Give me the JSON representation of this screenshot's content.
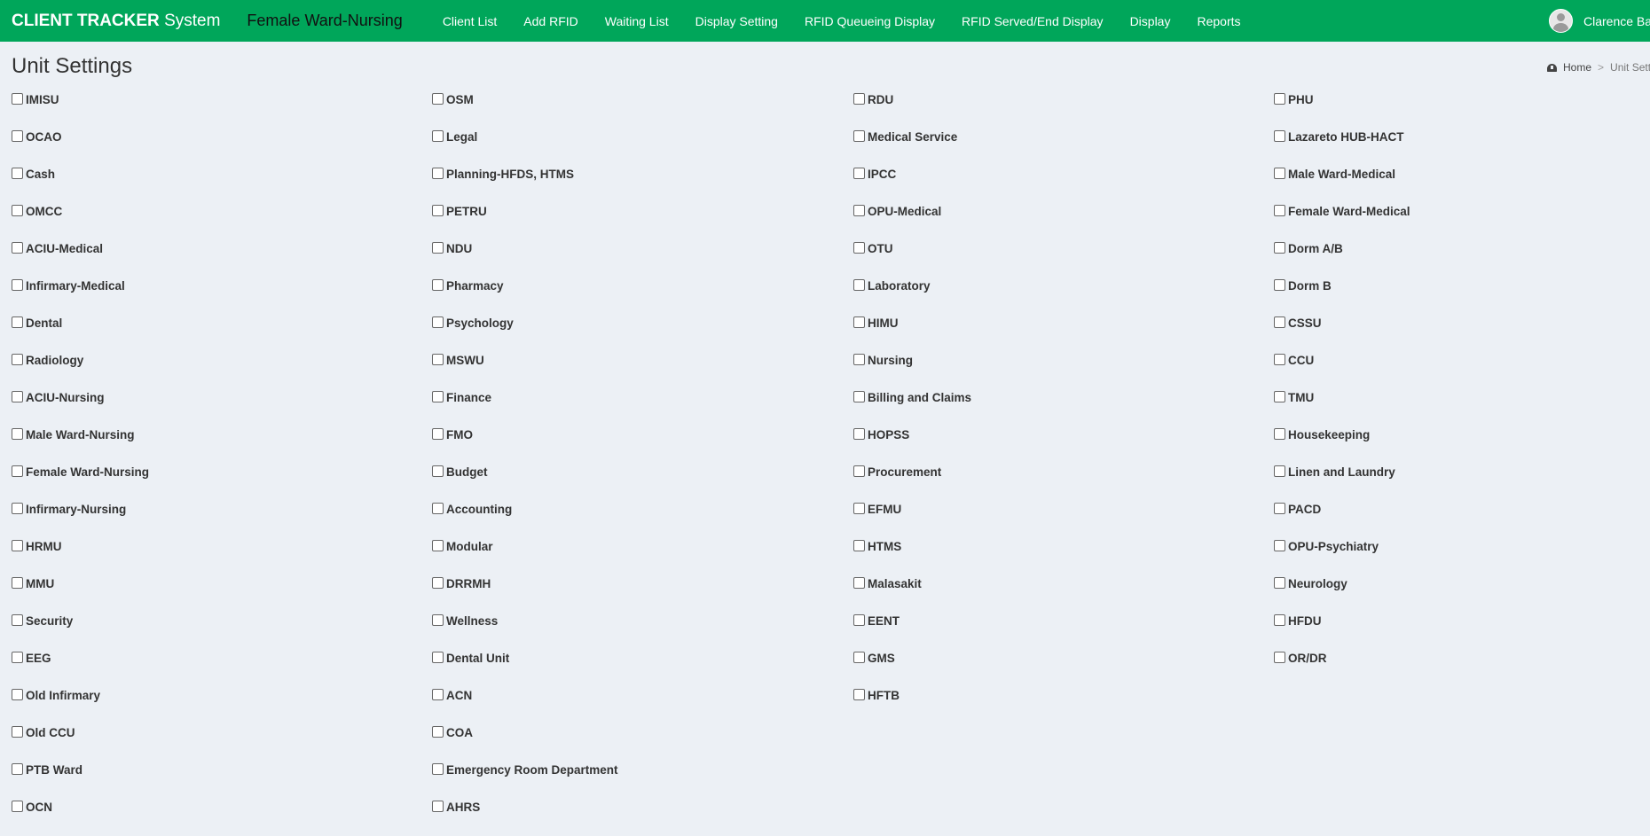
{
  "header": {
    "brand_bold": "CLIENT TRACKER",
    "brand_rest": "System",
    "ward": "Female Ward-Nursing",
    "nav": [
      "Client List",
      "Add RFID",
      "Waiting List",
      "Display Setting",
      "RFID Queueing Display",
      "RFID Served/End Display",
      "Display",
      "Reports"
    ],
    "user_name": "Clarence Balu"
  },
  "page": {
    "title": "Unit Settings",
    "breadcrumb": {
      "home": "Home",
      "current": "Unit Sett"
    }
  },
  "units": [
    [
      "IMISU",
      "OCAO",
      "Cash",
      "OMCC",
      "ACIU-Medical",
      "Infirmary-Medical",
      "Dental",
      "Radiology",
      "ACIU-Nursing",
      "Male Ward-Nursing",
      "Female Ward-Nursing",
      "Infirmary-Nursing",
      "HRMU",
      "MMU",
      "Security",
      "EEG",
      "Old Infirmary",
      "Old CCU",
      "PTB Ward",
      "OCN"
    ],
    [
      "OSM",
      "Legal",
      "Planning-HFDS, HTMS",
      "PETRU",
      "NDU",
      "Pharmacy",
      "Psychology",
      "MSWU",
      "Finance",
      "FMO",
      "Budget",
      "Accounting",
      "Modular",
      "DRRMH",
      "Wellness",
      "Dental Unit",
      "ACN",
      "COA",
      "Emergency Room Department",
      "AHRS"
    ],
    [
      "RDU",
      "Medical Service",
      "IPCC",
      "OPU-Medical",
      "OTU",
      "Laboratory",
      "HIMU",
      "Nursing",
      "Billing and Claims",
      "HOPSS",
      "Procurement",
      "EFMU",
      "HTMS",
      "Malasakit",
      "EENT",
      "GMS",
      "HFTB"
    ],
    [
      "PHU",
      "Lazareto HUB-HACT",
      "Male Ward-Medical",
      "Female Ward-Medical",
      "Dorm A/B",
      "Dorm B",
      "CSSU",
      "CCU",
      "TMU",
      "Housekeeping",
      "Linen and Laundry",
      "PACD",
      "OPU-Psychiatry",
      "Neurology",
      "HFDU",
      "OR/DR"
    ]
  ]
}
